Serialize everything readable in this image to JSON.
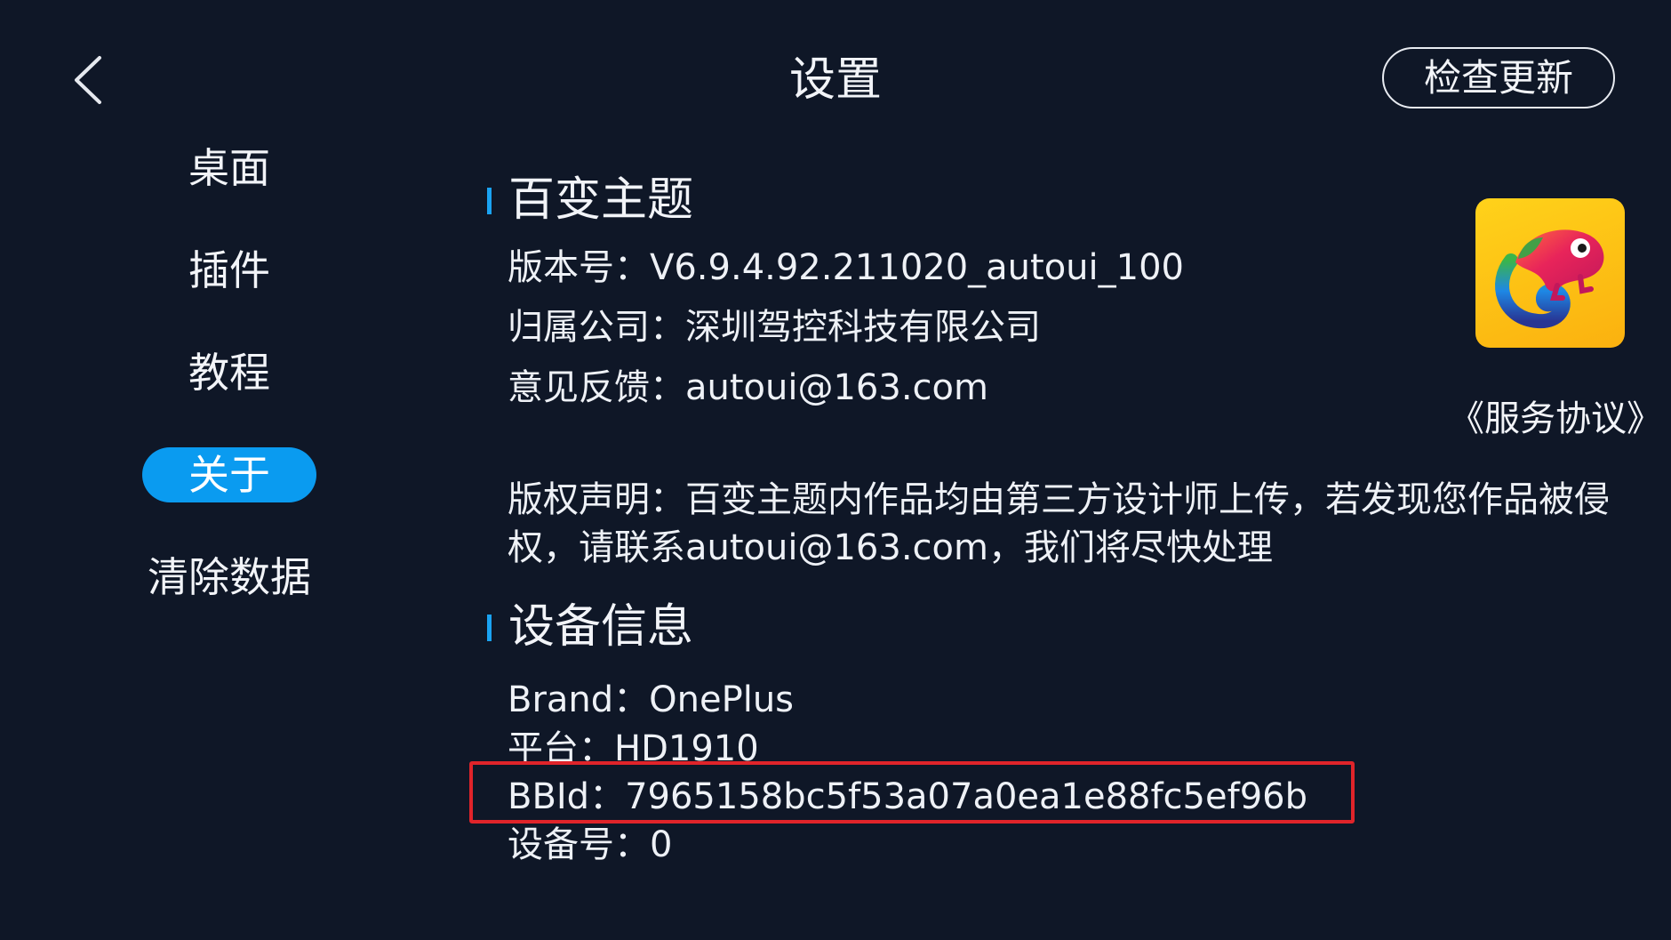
{
  "header": {
    "title": "设置",
    "back_icon": "chevron-left-icon",
    "check_update_label": "检查更新"
  },
  "sidebar": {
    "items": [
      {
        "label": "桌面",
        "active": false
      },
      {
        "label": "插件",
        "active": false
      },
      {
        "label": "教程",
        "active": false
      },
      {
        "label": "关于",
        "active": true
      },
      {
        "label": "清除数据",
        "active": false
      }
    ]
  },
  "about": {
    "section_title": "百变主题",
    "version": "版本号：V6.9.4.92.211020_autoui_100",
    "company": "归属公司：深圳驾控科技有限公司",
    "feedback": "意见反馈：autoui@163.com",
    "copyright": "版权声明：百变主题内作品均由第三方设计师上传，若发现您作品被侵权，请联系autoui@163.com，我们将尽快处理",
    "service_agreement": "《服务协议》",
    "app_icon": "chameleon-app-icon"
  },
  "device": {
    "section_title": "设备信息",
    "brand": "Brand：OnePlus",
    "platform": "平台：HD1910",
    "bbid": "BBId：7965158bc5f53a07a0ea1e88fc5ef96b",
    "device_no": "设备号：0"
  },
  "colors": {
    "background": "#0f1727",
    "accent": "#0a9bf0",
    "highlight": "#e0242a",
    "icon_background": "#fbc314"
  }
}
